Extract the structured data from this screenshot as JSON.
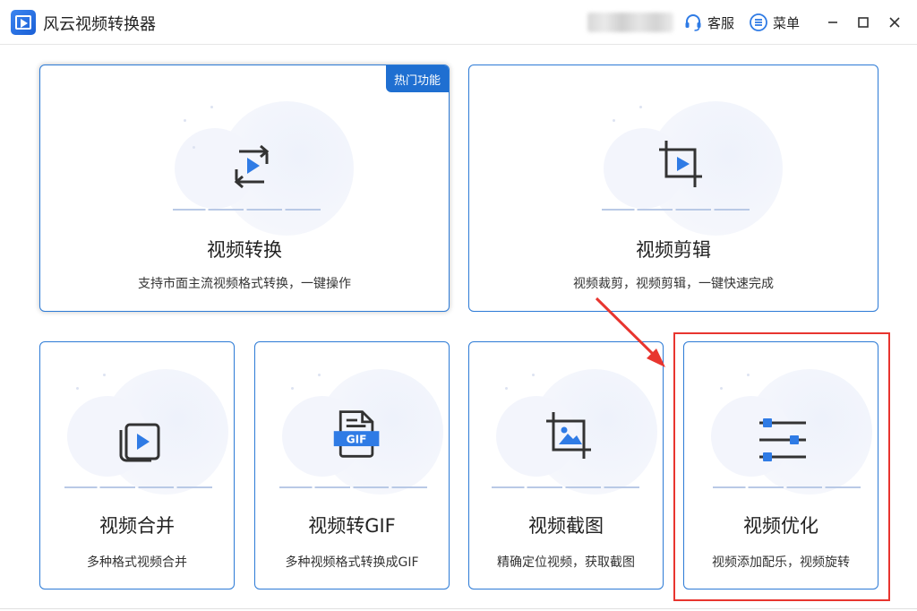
{
  "app": {
    "title": "风云视频转换器",
    "service_label": "客服",
    "menu_label": "菜单"
  },
  "colors": {
    "accent": "#1f6fd1",
    "card_border": "#2c7ad6",
    "icon_blue": "#2f7be5",
    "icon_dark": "#333333",
    "annotation_red": "#e8352f"
  },
  "cards": [
    {
      "id": "convert",
      "title": "视频转换",
      "desc": "支持市面主流视频格式转换，一键操作",
      "badge": "热门功能",
      "icon": "convert-video-icon"
    },
    {
      "id": "edit",
      "title": "视频剪辑",
      "desc": "视频裁剪，视频剪辑，一键快速完成",
      "icon": "crop-video-icon"
    },
    {
      "id": "merge",
      "title": "视频合并",
      "desc": "多种格式视频合并",
      "icon": "merge-video-icon"
    },
    {
      "id": "gif",
      "title": "视频转GIF",
      "desc": "多种视频格式转换成GIF",
      "icon": "gif-file-icon",
      "icon_text": "GIF"
    },
    {
      "id": "screenshot",
      "title": "视频截图",
      "desc": "精确定位视频，获取截图",
      "icon": "crop-image-icon"
    },
    {
      "id": "optimize",
      "title": "视频优化",
      "desc": "视频添加配乐，视频旋转",
      "icon": "sliders-icon"
    }
  ]
}
